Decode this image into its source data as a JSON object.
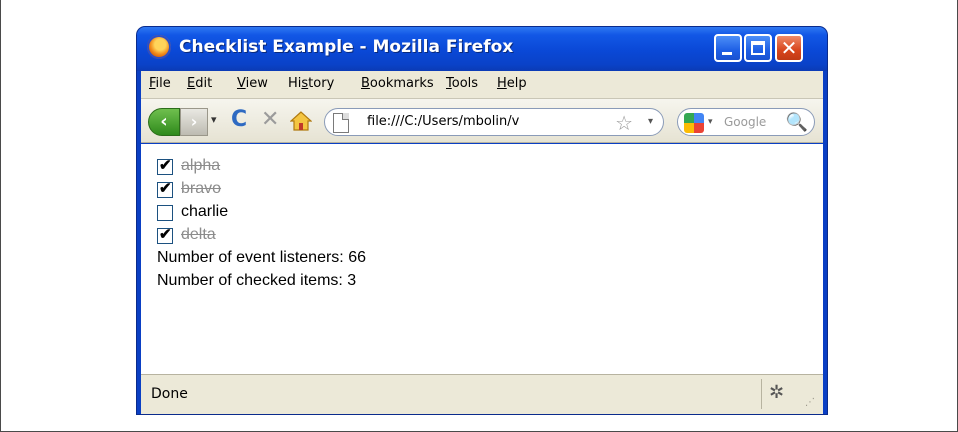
{
  "window": {
    "title": "Checklist Example - Mozilla Firefox",
    "min_icon": "minimize-icon",
    "max_icon": "maximize-icon",
    "close_icon": "close-icon",
    "close_glyph": "✕"
  },
  "menu": {
    "items": [
      {
        "accel": "F",
        "rest": "ile"
      },
      {
        "accel": "E",
        "rest": "dit"
      },
      {
        "accel": "V",
        "rest": "iew"
      },
      {
        "pre": "Hi",
        "accel": "s",
        "rest": "tory"
      },
      {
        "accel": "B",
        "rest": "ookmarks"
      },
      {
        "accel": "T",
        "rest": "ools"
      },
      {
        "accel": "H",
        "rest": "elp"
      }
    ]
  },
  "nav": {
    "back_glyph": "‹",
    "forward_glyph": "›",
    "dropdown_glyph": "▾",
    "reload_glyph": "C",
    "stop_glyph": "✕",
    "url": "file:///C:/Users/mbolin/v",
    "star_glyph": "☆",
    "url_drop_glyph": "▾",
    "search_placeholder": "Google",
    "search_drop_glyph": "▾",
    "search_glyph": "🔍"
  },
  "checklist": {
    "items": [
      {
        "label": "alpha",
        "checked": true
      },
      {
        "label": "bravo",
        "checked": true
      },
      {
        "label": "charlie",
        "checked": false
      },
      {
        "label": "delta",
        "checked": true
      }
    ],
    "check_glyph": "✔"
  },
  "stats": {
    "listeners": "Number of event listeners: 66",
    "checked": "Number of checked items: 3"
  },
  "status": {
    "text": "Done",
    "firebug_glyph": "✲",
    "grip_glyph": "⋰"
  },
  "colors": {
    "titlebar": "#0a48d6",
    "chrome": "#ece9d8",
    "done_text": "#8c8c8c"
  }
}
